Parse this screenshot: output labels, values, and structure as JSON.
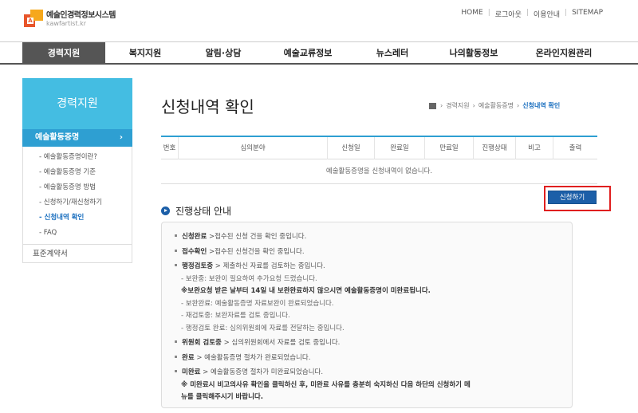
{
  "header": {
    "logo_title": "예술인경력정보시스템",
    "logo_sub": "kawfartist.kr",
    "util_links": [
      "HOME",
      "로그아웃",
      "이용안내",
      "SITEMAP"
    ]
  },
  "gnb": [
    "경력지원",
    "복지지원",
    "알림·상담",
    "예술교류정보",
    "뉴스레터",
    "나의활동정보",
    "온라인지원관리"
  ],
  "lnb": {
    "title": "경력지원",
    "current_section": "예술활동증명",
    "sub_items": [
      "예술활동증명이란?",
      "예술활동증명 기준",
      "예술활동증명 방법",
      "신청하기/재신청하기",
      "신청내역 확인",
      "FAQ"
    ],
    "extra": "표준계약서"
  },
  "page_title": "신청내역 확인",
  "breadcrumb": [
    "경력지원",
    "예술활동증명",
    "신청내역 확인"
  ],
  "table": {
    "headers": [
      "번호",
      "심의분야",
      "신청일",
      "완료일",
      "만료일",
      "진행상태",
      "비고",
      "출력"
    ],
    "empty_message": "예술활동증명을 신청내역이 없습니다."
  },
  "apply_button": "신청하기",
  "status_heading": "진행상태 안내",
  "status_lines": [
    {
      "type": "main",
      "bold": "신청완료",
      "text": " >접수된 신청 건을 확인 중입니다."
    },
    {
      "type": "main",
      "bold": "접수확인",
      "text": " >접수된 신청건을 확인 중입니다."
    },
    {
      "type": "main",
      "bold": "행정검토중",
      "text": " > 제출하신 자료를 검토하는 중입니다."
    },
    {
      "type": "sub",
      "text": "- 보완중: 보완이 필요하여 추가요청 드렸습니다."
    },
    {
      "type": "note",
      "text": "※보완요청 받은 날부터 14일 내 보완완료하지 않으시면 예술활동증명이 미완료됩니다."
    },
    {
      "type": "sub",
      "text": "- 보완완료: 예술활동증명 자료보완이 완료되었습니다."
    },
    {
      "type": "sub",
      "text": "- 재검토중: 보완자료를 검토 중입니다."
    },
    {
      "type": "sub",
      "text": "- 행정검토 완료: 심의위원회에 자료를 전달하는 중입니다."
    },
    {
      "type": "main",
      "bold": "위원회 검토중",
      "text": " > 심의위원회에서 자료를 검토 중입니다."
    },
    {
      "type": "main",
      "bold": "완료",
      "text": " > 예술활동증명 절차가 완료되었습니다."
    },
    {
      "type": "main",
      "bold": "미완료",
      "text": " > 예술활동증명 절차가 미완료되었습니다."
    },
    {
      "type": "note",
      "text": "※ 미완료시 비고의사유 확인을 클릭하신 후, 미완료 사유를 충분히 숙지하신 다음 하단의 신청하기 메"
    },
    {
      "type": "note",
      "text": "뉴를 클릭해주시기 바랍니다."
    }
  ]
}
